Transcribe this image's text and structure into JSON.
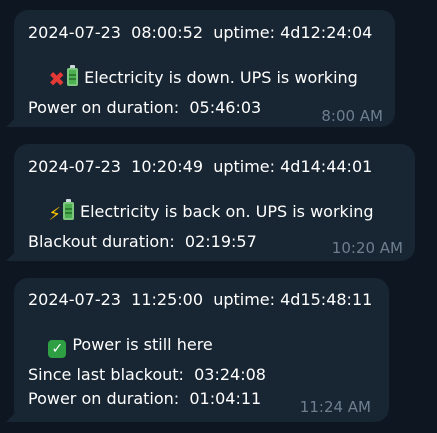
{
  "messages": [
    {
      "header": "2024-07-23  08:00:52  uptime: 4d12:24:04",
      "status_icons": [
        "cross-mark-icon",
        "battery-icon"
      ],
      "status_text": "Electricity is down. UPS is working",
      "details": [
        "Power on duration:  05:46:03"
      ],
      "time": "8:00 AM"
    },
    {
      "header": "2024-07-23  10:20:49  uptime: 4d14:44:01",
      "status_icons": [
        "lightning-icon",
        "battery-icon"
      ],
      "status_text": "Electricity is back on. UPS is working",
      "details": [
        "Blackout duration:  02:19:57"
      ],
      "time": "10:20 AM"
    },
    {
      "header": "2024-07-23  11:25:00  uptime: 4d15:48:11",
      "status_icons": [
        "check-mark-icon"
      ],
      "status_text": "Power is still here",
      "details": [
        "Since last blackout:  03:24:08",
        "Power on duration:  01:04:11"
      ],
      "time": "11:24 AM"
    }
  ],
  "colors": {
    "background": "#0e1621",
    "bubble": "#182533",
    "text": "#ffffff",
    "timestamp": "#6d7f8f"
  }
}
